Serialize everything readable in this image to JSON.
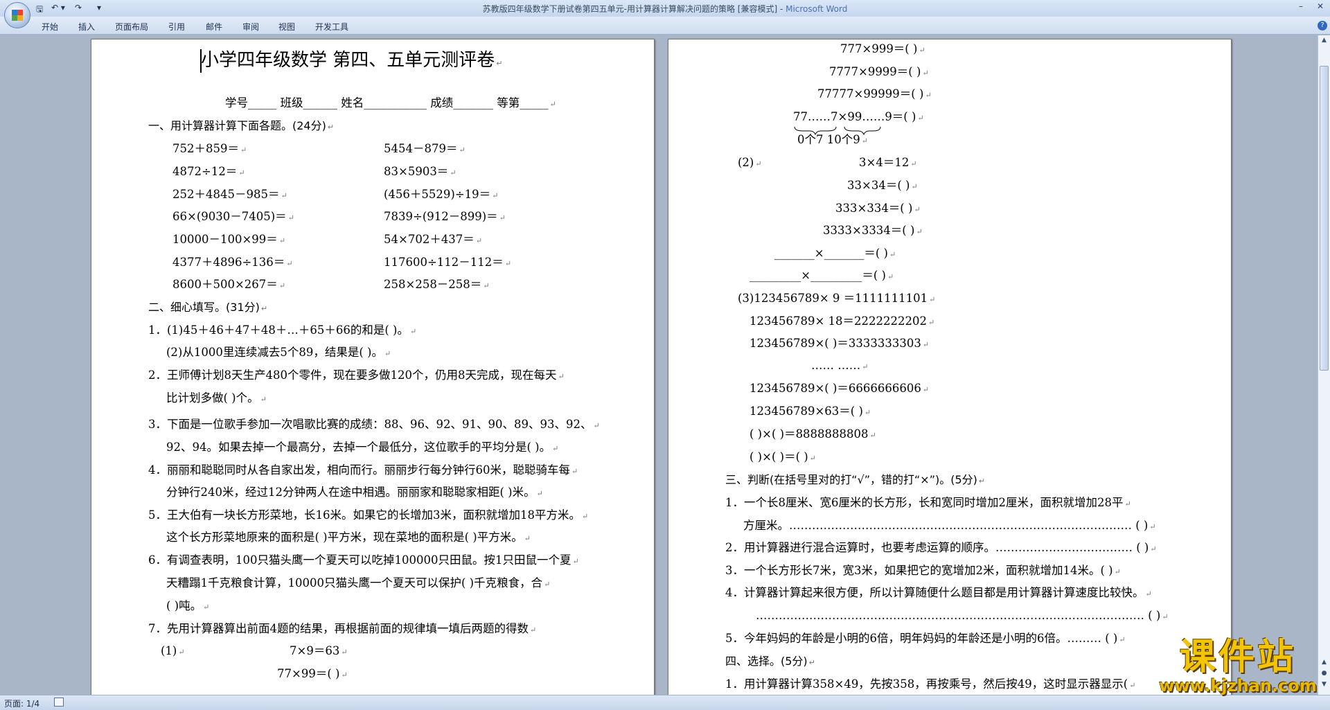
{
  "window": {
    "title": "苏教版四年级数学下册试卷第四五单元-用计算器计算解决问题的策略 [兼容模式]",
    "app": "Microsoft Word"
  },
  "qat": {
    "save": "🖫",
    "undo": "↶ ▾",
    "redo": "↷",
    "customize": "▾"
  },
  "ribbon": {
    "tabs": [
      "开始",
      "插入",
      "页面布局",
      "引用",
      "邮件",
      "审阅",
      "视图",
      "开发工具"
    ]
  },
  "status": {
    "page": "页面: 1/4"
  },
  "watermark": {
    "top": "课件站",
    "bottom": "www.kjzhan.com"
  },
  "page1": {
    "lines": [
      "小学四年级数学 第四、五单元测评卷",
      "学号_____ 班级______ 姓名___________ 成绩_______ 等第_____",
      "一、用计算器计算下面各题。(24分)",
      "752＋859＝",
      "5454－879＝",
      "4872÷12＝",
      "83×5903＝",
      "252＋4845－985＝",
      "(456＋5529)÷19＝",
      "66×(9030－7405)＝",
      "7839÷(912－899)＝",
      "10000－100×99＝",
      "54×702＋437＝",
      "4377＋4896÷136＝",
      "117600÷112－112＝",
      "8600＋500×267＝",
      "258×258－258＝",
      "二、细心填写。(31分)",
      "1．(1)45＋46＋47＋48＋…＋65＋66的和是( )。",
      "(2)从1000里连续减去5个89，结果是( )。",
      "2．王师傅计划8天生产480个零件，现在要多做120个，仍用8天完成，现在每天",
      "比计划多做( )个。",
      "3．下面是一位歌手参加一次唱歌比赛的成绩：88、96、92、91、90、89、93、92、",
      "92、94。如果去掉一个最高分，去掉一个最低分，这位歌手的平均分是( )。",
      "4．丽丽和聪聪同时从各自家出发，相向而行。丽丽步行每分钟行60米，聪聪骑车每",
      "分钟行240米，经过12分钟两人在途中相遇。丽丽家和聪聪家相距( )米。",
      "5．王大伯有一块长方形菜地，长16米。如果它的长增加3米，面积就增加18平方米。",
      "这个长方形菜地原来的面积是( )平方米，现在菜地的面积是( )平方米。",
      "6．有调查表明，100只猫头鹰一个夏天可以吃掉100000只田鼠。按1只田鼠一个夏",
      "天糟蹋1千克粮食计算，10000只猫头鹰一个夏天可以保护( )千克粮食，合",
      "( )吨。",
      "7．先用计算器算出前面4题的结果，再根据前面的规律填一填后两题的得数",
      "(1)",
      "7×9＝63",
      "77×99＝( )"
    ]
  },
  "page2": {
    "lines": [
      "777×999＝( )",
      "7777×9999＝( )",
      "77777×99999＝( )",
      "77……7×99……9＝( )",
      "0个7 10个9",
      "(2)",
      "3×4＝12",
      "33×34＝( )",
      "333×334＝( )",
      "3333×3334＝( )",
      "_______×_______＝( )",
      "_________×_________＝( )",
      "(3)123456789× 9 ＝1111111101",
      "123456789× 18＝2222222202",
      "123456789×( )＝3333333303",
      "…… ……",
      "123456789×( )＝6666666606",
      "123456789×63＝( )",
      "( )×( )＝8888888808",
      "( )×( )＝( )",
      "三、判断(在括号里对的打“√”，错的打“×”)。(5分)",
      "1．一个长8厘米、宽6厘米的长方形，长和宽同时增加2厘米，面积就增加28平",
      "方厘米。……………………………………………………………………………… ( )",
      "2．用计算器进行混合运算时，也要考虑运算的顺序。……………………………… ( )",
      "3．一个长方形长7米，宽3米，如果把它的宽增加2米，面积就增加14米。( )",
      "4．计算器计算起来很方便，所以计算随便什么题目都是用计算器计算速度比较快。",
      "………………………………………………………………………………………… ( )",
      "5．今年妈妈的年龄是小明的6倍，明年妈妈的年龄还是小明的6倍。……… ( )",
      "四、选择。(5分)",
      "1．用计算器计算358×49，先按358，再按乘号，然后按49，这时显示器显示("
    ]
  }
}
